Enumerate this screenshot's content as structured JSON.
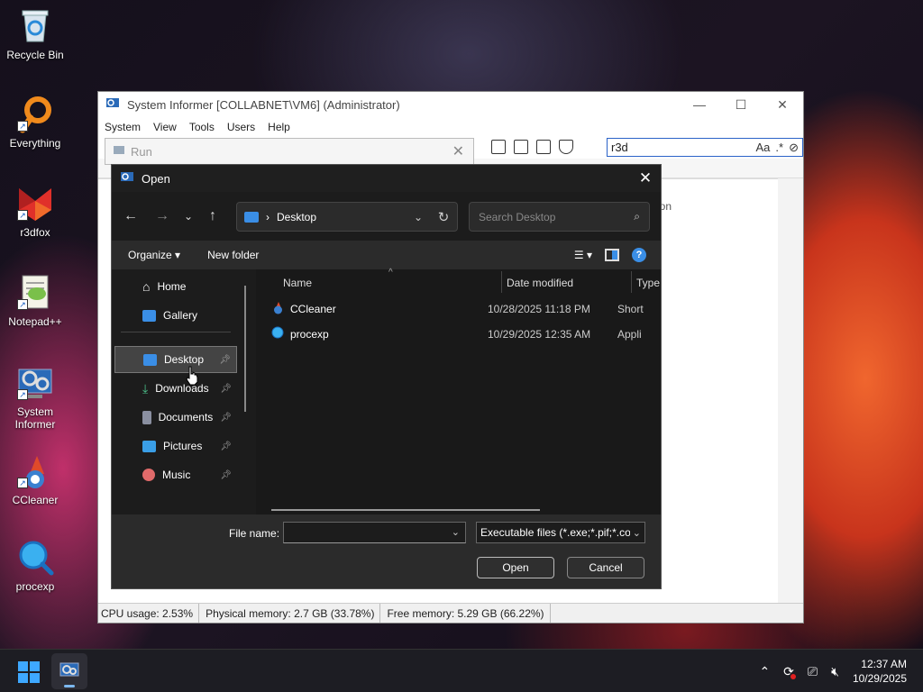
{
  "desktop": {
    "icons": [
      {
        "label": "Recycle Bin"
      },
      {
        "label": "Everything"
      },
      {
        "label": "r3dfox"
      },
      {
        "label": "Notepad++"
      },
      {
        "label": "System Informer"
      },
      {
        "label": "CCleaner"
      },
      {
        "label": "procexp"
      }
    ]
  },
  "system_informer": {
    "title": "System Informer [COLLABNET\\VM6] (Administrator)",
    "menu": [
      "System",
      "View",
      "Tools",
      "Users",
      "Help"
    ],
    "search_value": "r3d",
    "search_opt_case": "Aa",
    "search_opt_regex": ".*",
    "column_hint": "ion",
    "status": {
      "cpu": "CPU usage: 2.53%",
      "physical": "Physical memory: 2.7 GB (33.78%)",
      "free": "Free memory: 5.29 GB (66.22%)"
    }
  },
  "run_window": {
    "title": "Run"
  },
  "open_dialog": {
    "title": "Open",
    "address": "Desktop",
    "search_placeholder": "Search Desktop",
    "organize": "Organize",
    "new_folder": "New folder",
    "sidebar": [
      {
        "label": "Home",
        "pinned": false
      },
      {
        "label": "Gallery",
        "pinned": false
      },
      {
        "label": "Desktop",
        "pinned": true,
        "selected": true
      },
      {
        "label": "Downloads",
        "pinned": true
      },
      {
        "label": "Documents",
        "pinned": true
      },
      {
        "label": "Pictures",
        "pinned": true
      },
      {
        "label": "Music",
        "pinned": true
      }
    ],
    "columns": [
      "Name",
      "Date modified",
      "Type"
    ],
    "files": [
      {
        "name": "CCleaner",
        "date": "10/28/2025 11:18 PM",
        "type": "Short"
      },
      {
        "name": "procexp",
        "date": "10/29/2025 12:35 AM",
        "type": "Appli"
      }
    ],
    "file_name_label": "File name:",
    "file_name_value": "",
    "filter": "Executable files (*.exe;*.pif;*.com",
    "open_button": "Open",
    "cancel_button": "Cancel"
  },
  "taskbar": {
    "time": "12:37 AM",
    "date": "10/29/2025"
  },
  "colors": {
    "accent": "#3a8ee6",
    "dialog_bg": "#1c1c1c",
    "cmdbar_bg": "#2b2b2b",
    "taskbar_bg": "#1d1d23"
  }
}
